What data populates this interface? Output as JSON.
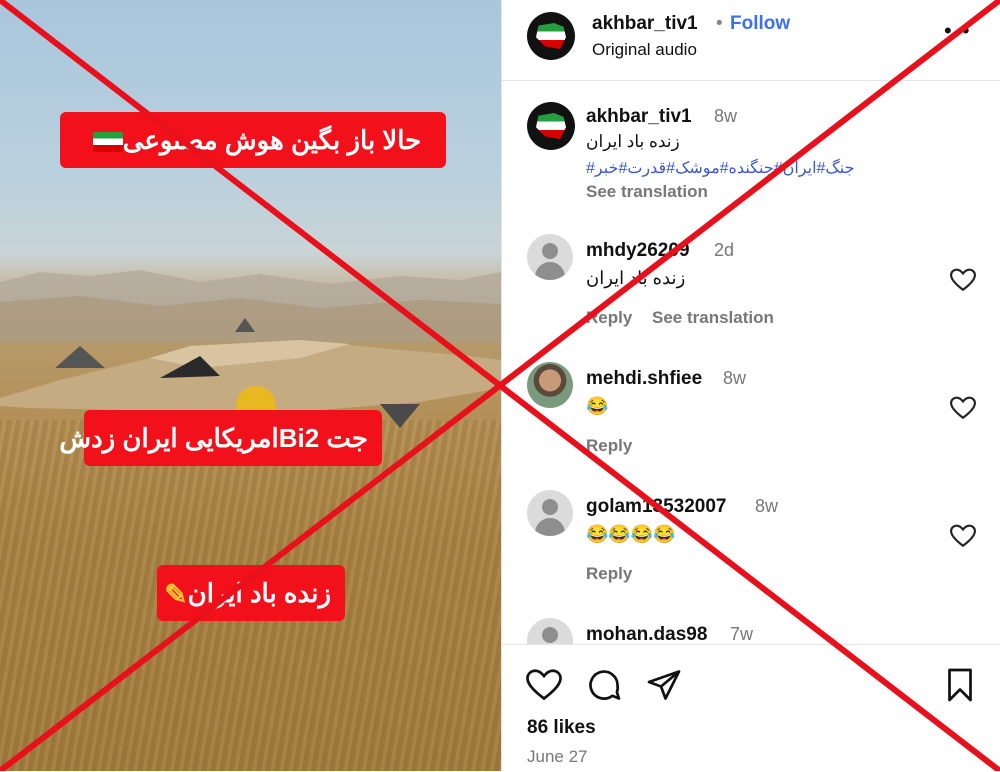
{
  "media": {
    "captions": [
      "حالا باز بگین هوش مصنوعی",
      "جت Bi2امریکایی ایران زدش",
      "زنده باد ایران"
    ],
    "flag_icon": "iran-flag-icon",
    "muscle_icon": "flexed-biceps-icon"
  },
  "header": {
    "username": "akhbar_tiv1",
    "separator": "•",
    "follow_label": "Follow",
    "audio": "Original audio",
    "more_label": "• •"
  },
  "post": {
    "username": "akhbar_tiv1",
    "time": "8w",
    "text": "زنده باد ایران",
    "tags": "جنگ#ایران#جنگنده#موشک#قدرت#خبر#",
    "see_translation": "See translation"
  },
  "comments": [
    {
      "username": "mhdy26209",
      "time": "2d",
      "text": "زنده باد ایران",
      "reply": "Reply",
      "see_translation": "See translation"
    },
    {
      "username": "mehdi.shfiee",
      "time": "8w",
      "text": "😂",
      "reply": "Reply"
    },
    {
      "username": "golam13532007",
      "time": "8w",
      "text": "😂😂😂😂",
      "reply": "Reply"
    },
    {
      "username": "mohan.das98",
      "time": "7w"
    }
  ],
  "footer": {
    "likes": "86 likes",
    "date": "June 27"
  },
  "colors": {
    "follow": "#3b6ff5",
    "caption_bg": "#f2101a",
    "overlay_x": "#e8101a",
    "hashtag": "#3b57d6"
  }
}
